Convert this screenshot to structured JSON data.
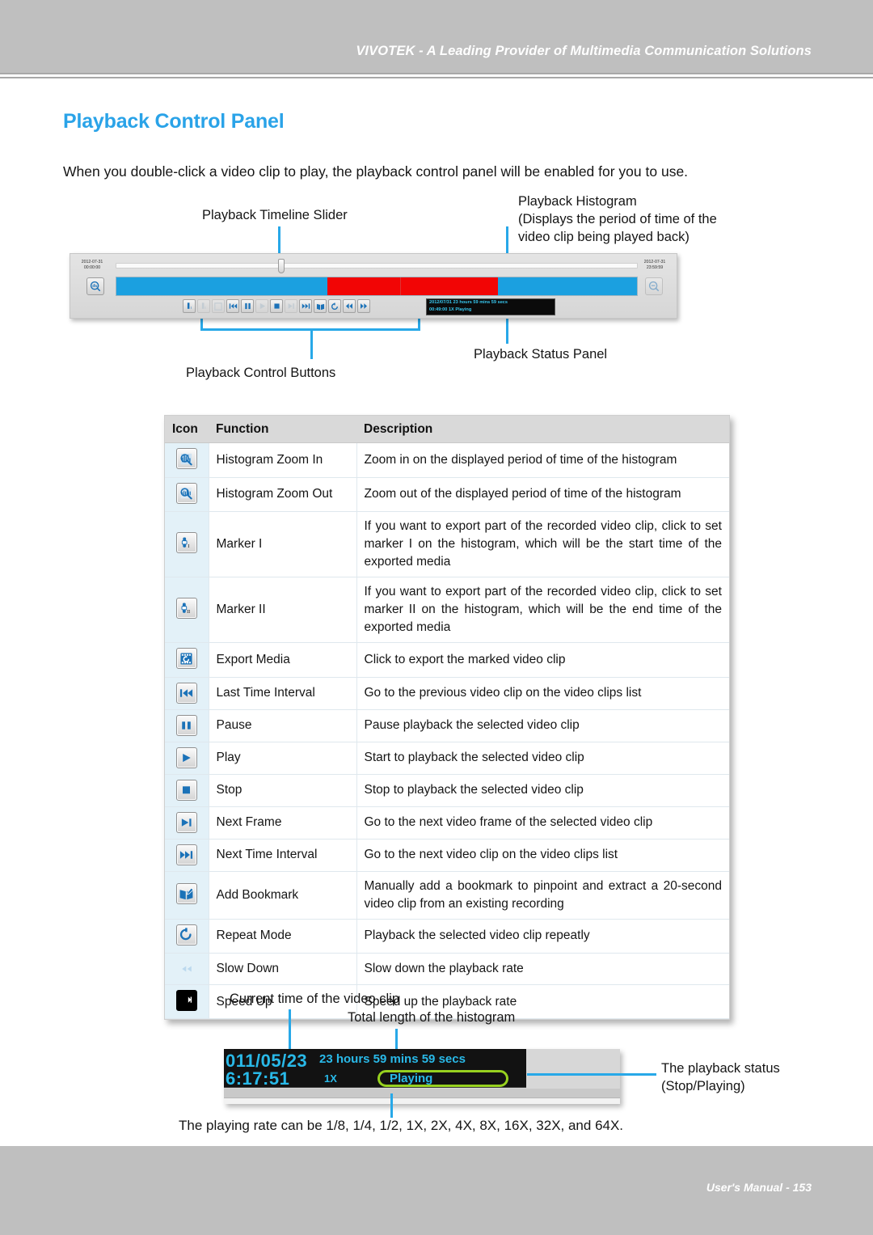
{
  "header": {
    "banner": "VIVOTEK - A Leading Provider of Multimedia Communication Solutions"
  },
  "footer": {
    "manual": "User's Manual - 153"
  },
  "page": {
    "title": "Playback Control Panel",
    "intro": "When you double-click a video clip to play, the playback control panel will be enabled for you to use."
  },
  "callouts": {
    "timeline_slider": "Playback Timeline Slider",
    "histogram_l1": "Playback Histogram",
    "histogram_l2": "(Displays the period of time of the",
    "histogram_l3": "video clip being played back)",
    "status_panel": "Playback Status Panel",
    "control_buttons": "Playback Control Buttons",
    "current_time": "Current time of the video clip",
    "total_length": "Total length of the histogram",
    "playback_status_l1": "The playback status",
    "playback_status_l2": "(Stop/Playing)"
  },
  "panel_shot": {
    "start_date": "2012-07-31",
    "start_time": "00:00:00",
    "end_date": "2012-07-31",
    "end_time": "23:59:59",
    "status_line1": "2012/07/31  23 hours 59 mins 59 secs",
    "status_line2": "00:49:00      1X            Playing"
  },
  "table": {
    "headers": [
      "Icon",
      "Function",
      "Description"
    ],
    "rows": [
      {
        "icon": "histogram-zoom-in-icon",
        "function": "Histogram Zoom In",
        "description": "Zoom in on the displayed period of time of the histogram",
        "justify": false
      },
      {
        "icon": "histogram-zoom-out-icon",
        "function": "Histogram Zoom Out",
        "description": "Zoom out of the displayed period of time of the histogram",
        "justify": false
      },
      {
        "icon": "marker-1-icon",
        "function": "Marker I",
        "description": "If you want to export part of the recorded video clip, click to set marker I on the histogram, which will be the start time of the exported media",
        "justify": true
      },
      {
        "icon": "marker-2-icon",
        "function": "Marker II",
        "description": "If you want to export part of the recorded video clip, click to set marker II on the histogram, which will be the end time of the exported media",
        "justify": true
      },
      {
        "icon": "export-media-icon",
        "function": "Export Media",
        "description": "Click to export the marked video clip",
        "justify": false
      },
      {
        "icon": "last-time-interval-icon",
        "function": "Last Time Interval",
        "description": "Go to the previous video clip on the video clips list",
        "justify": false
      },
      {
        "icon": "pause-icon",
        "function": "Pause",
        "description": "Pause playback the selected video clip",
        "justify": false
      },
      {
        "icon": "play-icon",
        "function": "Play",
        "description": "Start to playback the selected video clip",
        "justify": false
      },
      {
        "icon": "stop-icon",
        "function": "Stop",
        "description": "Stop to playback the selected video clip",
        "justify": false
      },
      {
        "icon": "next-frame-icon",
        "function": "Next Frame",
        "description": "Go to the next video frame of the selected video clip",
        "justify": false
      },
      {
        "icon": "next-time-interval-icon",
        "function": "Next Time Interval",
        "description": "Go to the next video clip on the video clips list",
        "justify": false
      },
      {
        "icon": "add-bookmark-icon",
        "function": "Add Bookmark",
        "description": "Manually add a bookmark to pinpoint and extract a 20-second video clip from an existing recording",
        "justify": true
      },
      {
        "icon": "repeat-mode-icon",
        "function": "Repeat Mode",
        "description": "Playback the selected video clip repeatly",
        "justify": false
      },
      {
        "icon": "slow-down-icon",
        "function": "Slow Down",
        "description": "Slow down the playback rate",
        "justify": false
      },
      {
        "icon": "speed-up-icon",
        "function": "Speed Up",
        "description": "Speed up the playback rate",
        "justify": false
      }
    ]
  },
  "zoom_shot": {
    "date": "011/05/23",
    "time": "6:17:51",
    "total": "23 hours 59 mins 59 secs",
    "rate": "1X",
    "state": "Playing"
  },
  "bottom_note": "The playing rate can be 1/8, 1/4, 1/2, 1X, 2X, 4X, 8X, 16X, 32X, and 64X.",
  "colors": {
    "accent": "#2aa3e8",
    "callout_line": "#28a8e8",
    "header_bg": "#bfbfbf",
    "histogram_blue": "#1ba0e0",
    "histogram_red": "#f20505",
    "status_text": "#29b9e8",
    "state_pill": "#97d11f"
  }
}
